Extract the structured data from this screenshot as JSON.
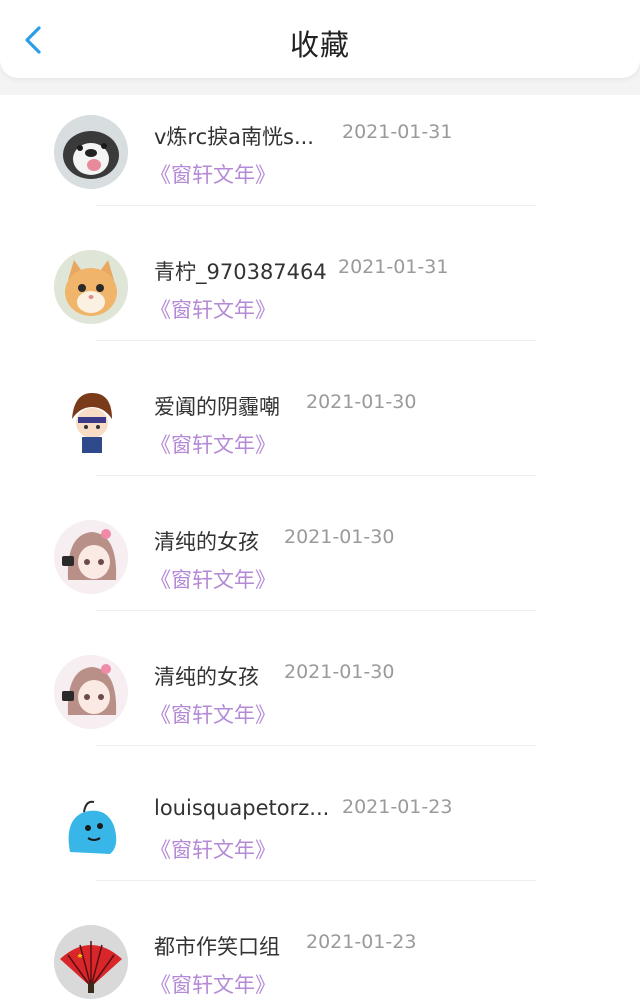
{
  "header": {
    "title": "收藏",
    "back_icon": "chevron-left-icon",
    "accent": "#2b9ee8"
  },
  "colors": {
    "book_title": "#b48ad6",
    "date": "#9a9a9a",
    "name": "#333333"
  },
  "items": [
    {
      "name": "v炼rc捩a南恍s...",
      "date": "2021-01-31",
      "book": "《窗轩文年》",
      "avatar": "husky-dog"
    },
    {
      "name": "青柠_970387464",
      "date": "2021-01-31",
      "book": "《窗轩文年》",
      "avatar": "orange-cat"
    },
    {
      "name": "爱阗的阴霾嘲",
      "date": "2021-01-30",
      "book": "《窗轩文年》",
      "avatar": "anime-boy"
    },
    {
      "name": "清纯的女孩",
      "date": "2021-01-30",
      "book": "《窗轩文年》",
      "avatar": "anime-girl"
    },
    {
      "name": "清纯的女孩",
      "date": "2021-01-30",
      "book": "《窗轩文年》",
      "avatar": "anime-girl"
    },
    {
      "name": "louisquapetorz...",
      "date": "2021-01-23",
      "book": "《窗轩文年》",
      "avatar": "blue-cartoon"
    },
    {
      "name": "都市作笑口组",
      "date": "2021-01-23",
      "book": "《窗轩文年》",
      "avatar": "red-fan"
    }
  ]
}
